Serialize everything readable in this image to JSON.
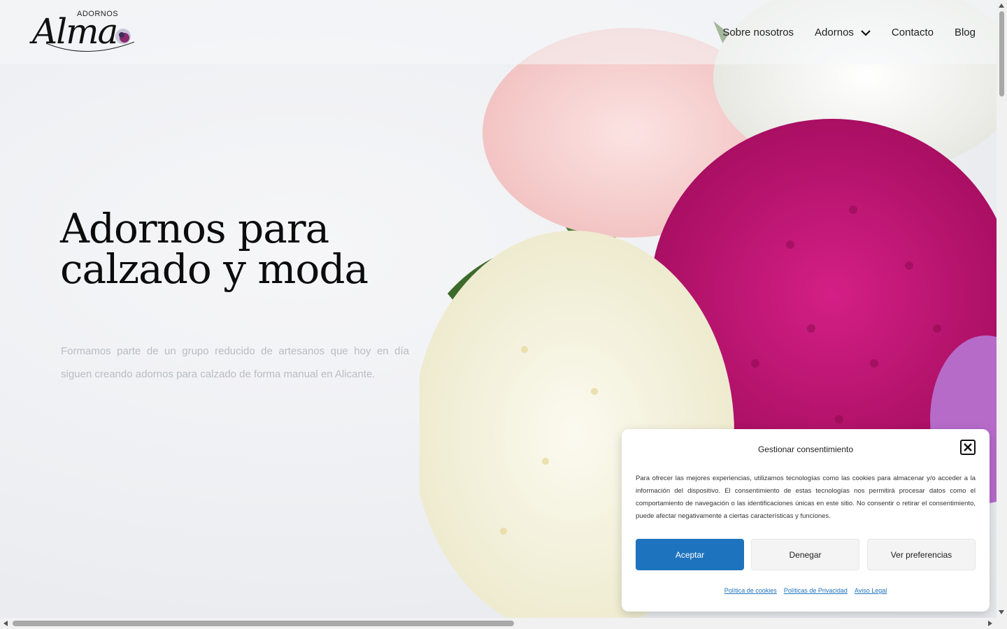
{
  "brand": {
    "logo_small": "ADORNOS",
    "logo_big": "Alma"
  },
  "nav": {
    "items": [
      {
        "label": "Sobre  nosotros"
      },
      {
        "label": "Adornos"
      },
      {
        "label": "Contacto"
      },
      {
        "label": "Blog"
      }
    ]
  },
  "hero": {
    "title_line1": "Adornos para",
    "title_line2": "calzado y moda",
    "intro": "Formamos parte de un grupo reducido de artesanos que hoy en día siguen creando adornos para calzado de forma manual en Alicante."
  },
  "cookie": {
    "title": "Gestionar  consentimiento",
    "body": "Para ofrecer las mejores experiencias, utilizamos tecnologías como las cookies para almacenar y/o acceder a la información del dispositivo. El consentimiento de estas tecnologías nos permitirá procesar datos como el comportamiento de navegación o las identificaciones únicas en este sitio. No consentir o retirar el consentimiento, puede afectar negativamente a ciertas características y funciones.",
    "accept": "Aceptar",
    "deny": "Denegar",
    "preferences": "Ver  preferencias",
    "links": [
      "Política  de  cookies",
      "Políticas  de  Privacidad",
      "Aviso  Legal"
    ]
  },
  "colors": {
    "accent": "#1e73be",
    "magenta": "#c2187a",
    "cream": "#f5f3df",
    "pink": "#f6c9c9",
    "leaf": "#4e7a35"
  },
  "icons": {
    "close": "close-icon",
    "dropdown": "chevron-down-icon"
  }
}
